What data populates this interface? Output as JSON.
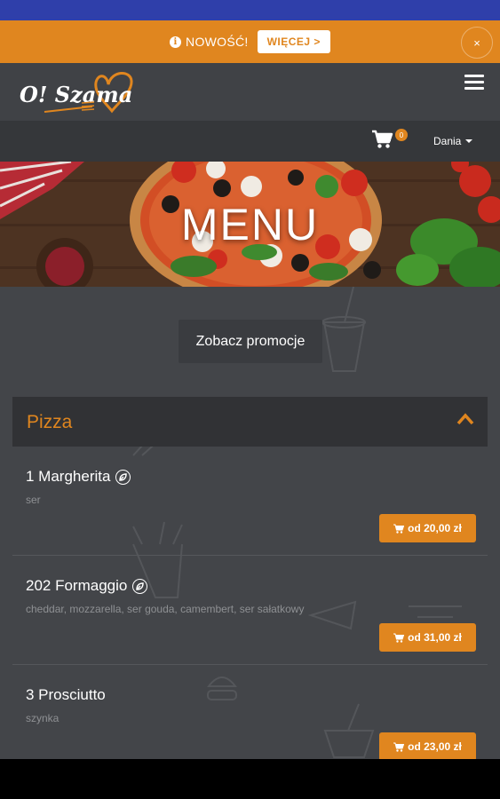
{
  "notice": {
    "text": "NOWOŚĆ!",
    "more_label": "WIĘCEJ >",
    "close_label": "×"
  },
  "header": {
    "logo_text": "O! Szama",
    "cart_count": "0",
    "nav_dropdown_label": "Dania"
  },
  "hero": {
    "title": "MENU"
  },
  "promo_button_label": "Zobacz promocje",
  "category": {
    "title": "Pizza"
  },
  "items": [
    {
      "name": "1 Margherita",
      "description": "ser",
      "price_label": "od 20,00 zł"
    },
    {
      "name": "202 Formaggio",
      "description": "cheddar, mozzarella, ser gouda, camembert, ser sałatkowy",
      "price_label": "od 31,00 zł"
    },
    {
      "name": "3 Prosciutto",
      "description": "szynka",
      "price_label": "od 23,00 zł"
    }
  ],
  "colors": {
    "accent": "#e0861f",
    "status_bar": "#2f3faa",
    "background": "#434549"
  }
}
